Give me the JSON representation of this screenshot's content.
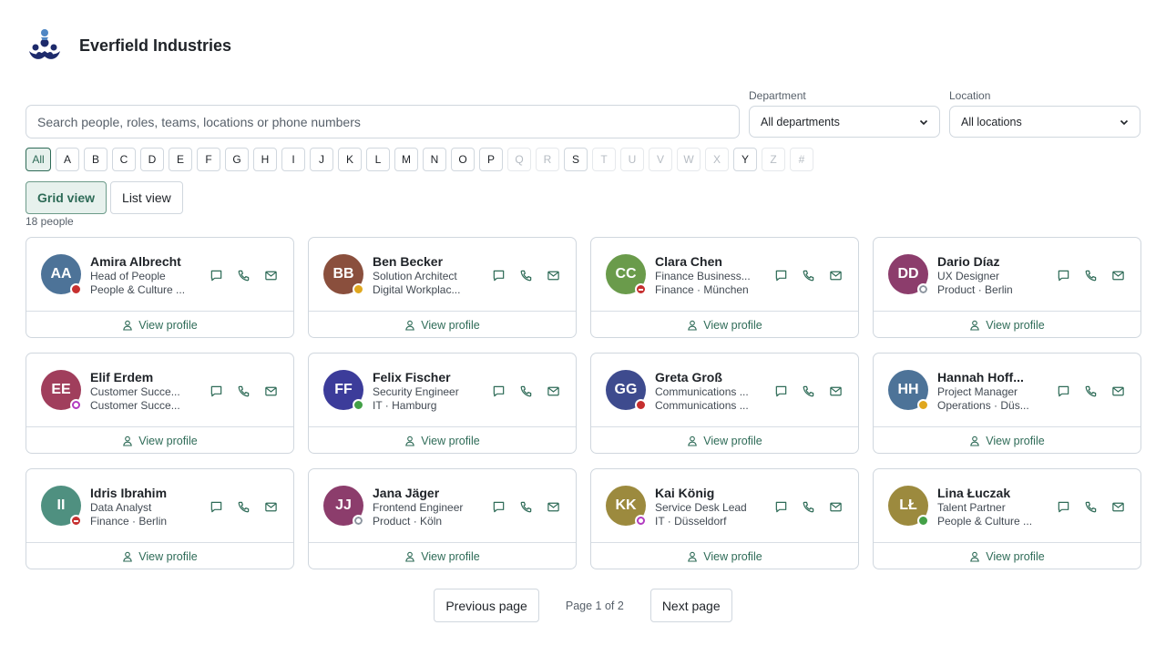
{
  "brand": {
    "name": "Everfield Industries"
  },
  "search": {
    "placeholder": "Search people, roles, teams, locations or phone numbers",
    "value": ""
  },
  "filters": {
    "department": {
      "label": "Department",
      "selected": "All departments"
    },
    "location": {
      "label": "Location",
      "selected": "All locations"
    }
  },
  "alphabet": [
    {
      "label": "All",
      "active": true,
      "enabled": true
    },
    {
      "label": "A",
      "enabled": true
    },
    {
      "label": "B",
      "enabled": true
    },
    {
      "label": "C",
      "enabled": true
    },
    {
      "label": "D",
      "enabled": true
    },
    {
      "label": "E",
      "enabled": true
    },
    {
      "label": "F",
      "enabled": true
    },
    {
      "label": "G",
      "enabled": true
    },
    {
      "label": "H",
      "enabled": true
    },
    {
      "label": "I",
      "enabled": true
    },
    {
      "label": "J",
      "enabled": true
    },
    {
      "label": "K",
      "enabled": true
    },
    {
      "label": "L",
      "enabled": true
    },
    {
      "label": "M",
      "enabled": true
    },
    {
      "label": "N",
      "enabled": true
    },
    {
      "label": "O",
      "enabled": true
    },
    {
      "label": "P",
      "enabled": true
    },
    {
      "label": "Q",
      "enabled": false
    },
    {
      "label": "R",
      "enabled": false
    },
    {
      "label": "S",
      "enabled": true
    },
    {
      "label": "T",
      "enabled": false
    },
    {
      "label": "U",
      "enabled": false
    },
    {
      "label": "V",
      "enabled": false
    },
    {
      "label": "W",
      "enabled": false
    },
    {
      "label": "X",
      "enabled": false
    },
    {
      "label": "Y",
      "enabled": true
    },
    {
      "label": "Z",
      "enabled": false
    },
    {
      "label": "#",
      "enabled": false
    }
  ],
  "views": {
    "grid_label": "Grid view",
    "list_label": "List view",
    "active": "grid"
  },
  "count_text": "18 people",
  "view_profile_label": "View profile",
  "icons": {
    "message": "chat-icon",
    "call": "phone-icon",
    "email": "mail-icon",
    "profile": "person-icon"
  },
  "colors": {
    "accent": "#2e6b57"
  },
  "people": [
    {
      "initials": "AA",
      "name": "Amira Albrecht",
      "role": "Head of People",
      "team": "People & Culture ...",
      "status": "busy",
      "color": "#4d7398"
    },
    {
      "initials": "BB",
      "name": "Ben Becker",
      "role": "Solution Architect",
      "team": "Digital Workplac...",
      "status": "away",
      "color": "#8a4f3d"
    },
    {
      "initials": "CC",
      "name": "Clara Chen",
      "role": "Finance Business...",
      "team": "Finance · München",
      "status": "dnd",
      "color": "#6a9b4b"
    },
    {
      "initials": "DD",
      "name": "Dario Díaz",
      "role": "UX Designer",
      "team": "Product · Berlin",
      "status": "offline",
      "color": "#8c3d6c"
    },
    {
      "initials": "EE",
      "name": "Elif Erdem",
      "role": "Customer Succe...",
      "team": "Customer Succe...",
      "status": "ooo",
      "color": "#a03e5c"
    },
    {
      "initials": "FF",
      "name": "Felix Fischer",
      "role": "Security Engineer",
      "team": "IT · Hamburg",
      "status": "available",
      "color": "#3c3c9a"
    },
    {
      "initials": "GG",
      "name": "Greta Groß",
      "role": "Communications ...",
      "team": "Communications ...",
      "status": "busy",
      "color": "#3e4b8e"
    },
    {
      "initials": "HH",
      "name": "Hannah Hoff...",
      "role": "Project Manager",
      "team": "Operations · Düs...",
      "status": "away",
      "color": "#4d7398"
    },
    {
      "initials": "II",
      "name": "Idris Ibrahim",
      "role": "Data Analyst",
      "team": "Finance · Berlin",
      "status": "dnd",
      "color": "#4f9080"
    },
    {
      "initials": "JJ",
      "name": "Jana Jäger",
      "role": "Frontend Engineer",
      "team": "Product · Köln",
      "status": "offline",
      "color": "#8c3d6c"
    },
    {
      "initials": "KK",
      "name": "Kai König",
      "role": "Service Desk Lead",
      "team": "IT · Düsseldorf",
      "status": "ooo",
      "color": "#9c8a3e"
    },
    {
      "initials": "LŁ",
      "name": "Lina Łuczak",
      "role": "Talent Partner",
      "team": "People & Culture ...",
      "status": "available",
      "color": "#9c8a3e"
    }
  ],
  "pagination": {
    "prev_label": "Previous page",
    "info": "Page 1 of 2",
    "next_label": "Next page"
  }
}
